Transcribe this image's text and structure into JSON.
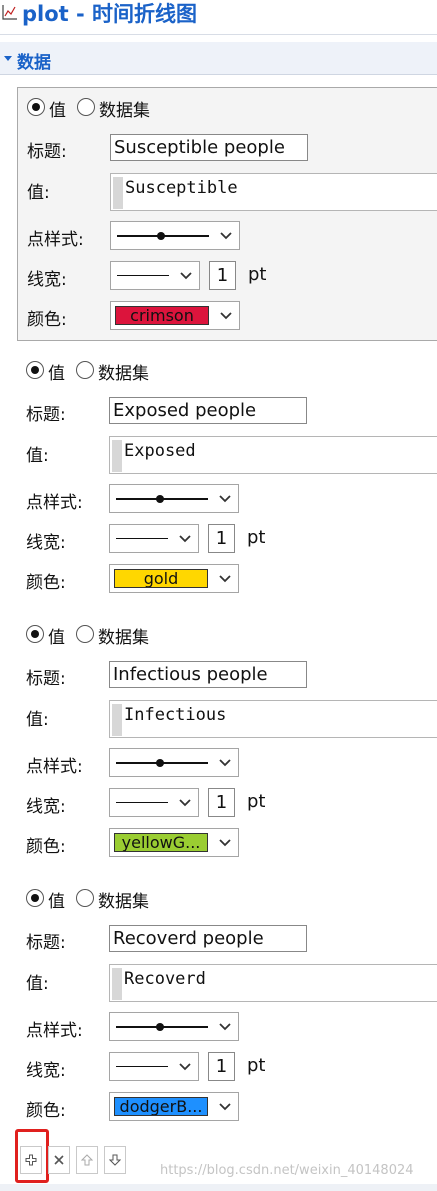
{
  "header": {
    "title": "plot - 时间折线图",
    "icon": "chart-icon"
  },
  "section": {
    "label": "数据"
  },
  "labels": {
    "value_radio": "值",
    "dataset_radio": "数据集",
    "title": "标题:",
    "value": "值:",
    "point_style": "点样式:",
    "line_width": "线宽:",
    "color": "颜色:",
    "unit": "pt"
  },
  "series": [
    {
      "title": "Susceptible people",
      "value": "Susceptible",
      "line_width": "1",
      "color_name": "crimson",
      "color_hex": "#dc143c",
      "selected": "值"
    },
    {
      "title": "Exposed people",
      "value": "Exposed",
      "line_width": "1",
      "color_name": "gold",
      "color_hex": "#ffd700",
      "selected": "值"
    },
    {
      "title": "Infectious people",
      "value": "Infectious",
      "line_width": "1",
      "color_name": "yellowG...",
      "color_hex": "#9acd32",
      "selected": "值"
    },
    {
      "title": "Recoverd people",
      "value": "Recoverd",
      "line_width": "1",
      "color_name": "dodgerB...",
      "color_hex": "#1e90ff",
      "selected": "值"
    }
  ],
  "toolbar": {
    "buttons": [
      "plus-icon",
      "close-icon",
      "arrow-up-icon",
      "arrow-down-icon"
    ]
  },
  "watermark": "https://blog.csdn.net/weixin_40148024"
}
